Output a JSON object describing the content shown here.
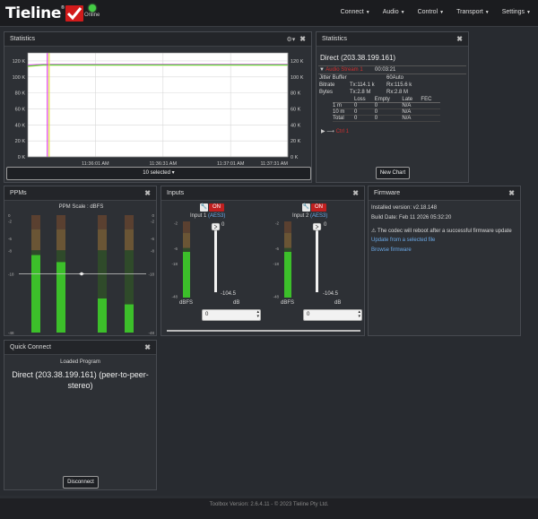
{
  "header": {
    "logo_text": "Tieline",
    "status_label": "Online",
    "menu": [
      "Connect",
      "Audio",
      "Control",
      "Transport",
      "Settings"
    ]
  },
  "graph_panel": {
    "title": "Statistics",
    "y_ticks": [
      "120 K",
      "100 K",
      "80 K",
      "60 K",
      "40 K",
      "20 K",
      "0 K"
    ],
    "x_ticks": [
      "11:36:01 AM",
      "11:36:31 AM",
      "11:37:01 AM",
      "11:37:31 AM"
    ],
    "selector_label": "10 selected"
  },
  "chart_data": {
    "type": "line",
    "x": [
      "11:35:40 AM",
      "11:36:01 AM",
      "11:36:31 AM",
      "11:37:01 AM",
      "11:37:31 AM",
      "11:37:40 AM"
    ],
    "ylim": [
      0,
      130000
    ],
    "yticks": [
      0,
      20000,
      40000,
      60000,
      80000,
      100000,
      120000
    ],
    "grid": true,
    "series": [
      {
        "color": "#e8e8e8",
        "values": [
          114000,
          114000,
          114000,
          114000,
          114000,
          114000
        ]
      },
      {
        "color": "#e040e0",
        "values": [
          115000,
          115600,
          115600,
          115600,
          115600,
          115600
        ]
      },
      {
        "color": "#e0e040",
        "values": [
          113000,
          114500,
          114500,
          114500,
          114500,
          114500
        ]
      },
      {
        "color": "#40e040",
        "values": [
          113500,
          115000,
          115000,
          115000,
          115000,
          115000
        ]
      }
    ]
  },
  "stats_panel": {
    "title": "Statistics",
    "connection": "Direct (203.38.199.161)",
    "stream_label": "Audio Stream 1",
    "stream_time": "00:03:21",
    "jitter_label": "Jitter Buffer",
    "jitter_value": "60Auto",
    "bitrate_label": "Bitrate",
    "bitrate_tx": "Tx:114.1 k",
    "bitrate_rx": "Rx:115.6 k",
    "bytes_label": "Bytes",
    "bytes_tx": "Tx:2.8 M",
    "bytes_rx": "Rx:2.8 M",
    "table_headers": [
      "",
      "Loss",
      "Empty",
      "Late",
      "FEC"
    ],
    "table_rows": [
      [
        "1 m",
        "0",
        "0",
        "N/A",
        ""
      ],
      [
        "10 m",
        "0",
        "0",
        "N/A",
        ""
      ],
      [
        "Total",
        "0",
        "0",
        "N/A",
        ""
      ]
    ],
    "ctrl_label": "Ctrl 1",
    "new_chart_label": "New Chart"
  },
  "ppms_panel": {
    "title": "PPMs",
    "scale_label": "PPM Scale : dBFS",
    "scale_ticks": [
      "0",
      "-2",
      "-6",
      "-8",
      "-18",
      "-48"
    ],
    "levels": [
      0.66,
      0.6,
      0.29,
      0.24
    ]
  },
  "inputs_panel": {
    "title": "Inputs",
    "channels": [
      {
        "name": "Input 1",
        "source": "(AES3)",
        "on_label": "ON",
        "fader_top": "0",
        "fader_bottom": "-104.5",
        "dbfs_label": "dBFS",
        "db_label": "dB",
        "gain_value": "0",
        "meter_ticks": [
          "-2",
          "-6",
          "-18",
          "-48"
        ],
        "meter_level": 0.6
      },
      {
        "name": "Input 2",
        "source": "(AES3)",
        "on_label": "ON",
        "fader_top": "0",
        "fader_bottom": "-104.5",
        "dbfs_label": "dBFS",
        "db_label": "dB",
        "gain_value": "0",
        "meter_ticks": [
          "-2",
          "-6",
          "-18",
          "-48"
        ],
        "meter_level": 0.6
      }
    ]
  },
  "firmware_panel": {
    "title": "Firmware",
    "installed": "Installed version: v2.18.148",
    "build_date": "Build Date: Feb 11 2026 05:32:20",
    "warning": "The codec will reboot after a successful firmware update",
    "update_link": "Update from a selected file",
    "browse_link": "Browse firmware"
  },
  "quick_connect": {
    "title": "Quick Connect",
    "loaded_label": "Loaded Program",
    "program": "Direct (203.38.199.161) (peer-to-peer-stereo)",
    "disconnect_label": "Disconnect"
  },
  "footer": {
    "text": "Toolbox Version: 2.6.4.11 - © 2023 Tieline Pty Ltd."
  }
}
